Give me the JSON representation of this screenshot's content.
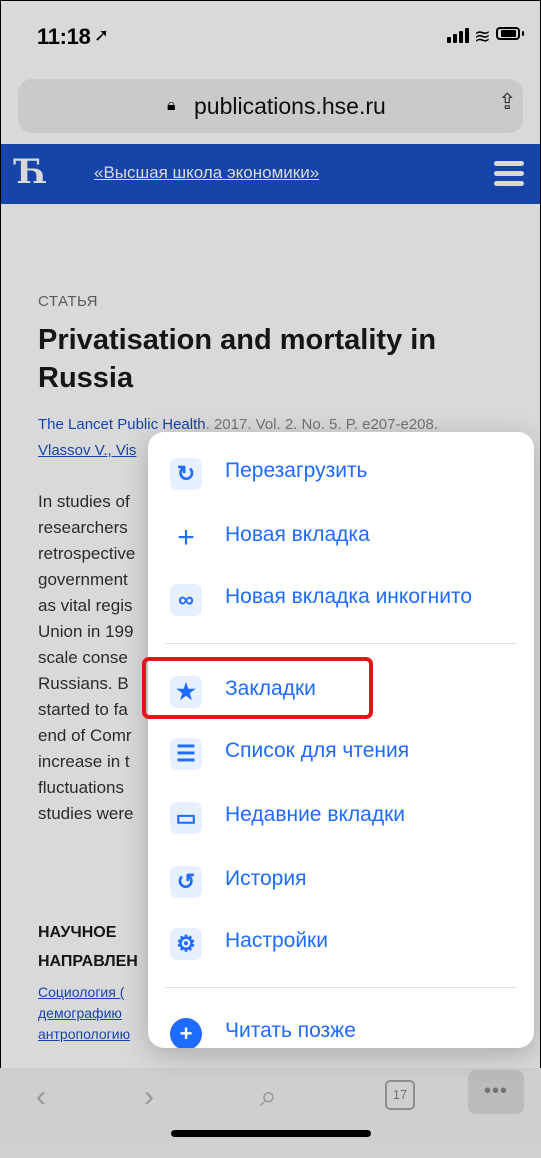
{
  "status_bar": {
    "time": "11:18",
    "location_icon": "location-arrow-icon",
    "signal_icon": "cell-signal-icon",
    "wifi_icon": "wifi-icon",
    "battery_icon": "battery-icon"
  },
  "address_bar": {
    "lock_icon": "lock-icon",
    "url": "publications.hse.ru",
    "share_icon": "share-icon"
  },
  "site_header": {
    "logo": "Ћ",
    "site_name": "«Высшая школа экономики»",
    "menu_icon": "hamburger-icon"
  },
  "article": {
    "kicker": "СТАТЬЯ",
    "title": "Privatisation and mortality in Russia",
    "journal": "The Lancet Public Health",
    "meta": ". 2017. Vol. 2. No. 5. P. e207-e208.",
    "author": "Vlassov V.",
    "author_partial": "Vis",
    "abstract_lines": [
      "In studies of",
      "researchers",
      "retrospective",
      "government",
      "as vital regis",
      "Union in 199",
      "scale conse",
      "Russians. B",
      "started to fa",
      "end of Comr",
      "increase in t",
      "fluctuations",
      "studies were"
    ],
    "section_lines": [
      "НАУЧНОЕ",
      "НАПРАВЛЕН"
    ],
    "tags": [
      "Социология (",
      "демографию",
      "антропологию"
    ]
  },
  "menu": {
    "items": [
      {
        "label": "Перезагрузить",
        "icon": "reload-icon",
        "glyph": "↻"
      },
      {
        "label": "Новая вкладка",
        "icon": "plus-icon",
        "glyph": "+"
      },
      {
        "label": "Новая вкладка инкогнито",
        "icon": "incognito-icon",
        "glyph": "∞"
      },
      {
        "label": "Закладки",
        "icon": "star-icon",
        "glyph": "★"
      },
      {
        "label": "Список для чтения",
        "icon": "reading-list-icon",
        "glyph": "☰"
      },
      {
        "label": "Недавние вкладки",
        "icon": "recent-tabs-icon",
        "glyph": "▭"
      },
      {
        "label": "История",
        "icon": "history-icon",
        "glyph": "↺"
      },
      {
        "label": "Настройки",
        "icon": "gear-icon",
        "glyph": "⚙"
      },
      {
        "label": "Читать позже",
        "icon": "read-later-icon",
        "glyph": "+"
      }
    ]
  },
  "toolbar": {
    "back": "‹",
    "forward": "›",
    "search": "⌕",
    "tabs_count": "17",
    "more": "•••"
  },
  "colors": {
    "accent": "#1e6bff",
    "site_blue": "#1c51c7",
    "highlight": "#e3151a"
  }
}
